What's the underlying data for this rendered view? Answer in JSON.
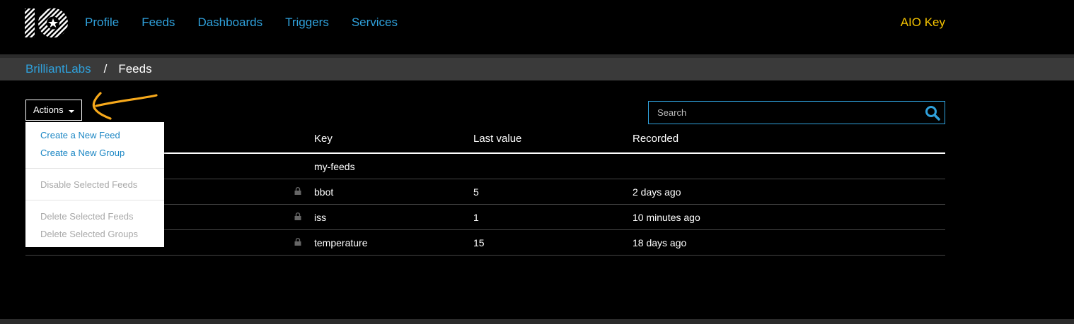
{
  "nav": {
    "items": [
      "Profile",
      "Feeds",
      "Dashboards",
      "Triggers",
      "Services"
    ],
    "aio_key": "AIO Key"
  },
  "breadcrumb": {
    "parent": "BrilliantLabs",
    "separator": "/",
    "current": "Feeds"
  },
  "toolbar": {
    "actions_label": "Actions",
    "search_placeholder": "Search"
  },
  "table": {
    "headers": [
      "Key",
      "Last value",
      "Recorded"
    ],
    "rows": [
      {
        "key": "my-feeds",
        "last_value": "",
        "recorded": ""
      },
      {
        "key": "bbot",
        "last_value": "5",
        "recorded": "2 days ago"
      },
      {
        "key": "iss",
        "last_value": "1",
        "recorded": "10 minutes ago"
      },
      {
        "key": "temperature",
        "last_value": "15",
        "recorded": "18 days ago"
      }
    ]
  },
  "actions_menu": {
    "create_feed": "Create a New Feed",
    "create_group": "Create a New Group",
    "disable_feeds": "Disable Selected Feeds",
    "delete_feeds": "Delete Selected Feeds",
    "delete_groups": "Delete Selected Groups"
  },
  "colors": {
    "accent": "#2fa1dc",
    "aio_key": "#f6c400",
    "annotation_arrow": "#f7a91b",
    "background": "#000000"
  },
  "icons": [
    "io-logo-icon",
    "caret-down-icon",
    "search-icon",
    "lock-icon",
    "annotation-arrow"
  ]
}
